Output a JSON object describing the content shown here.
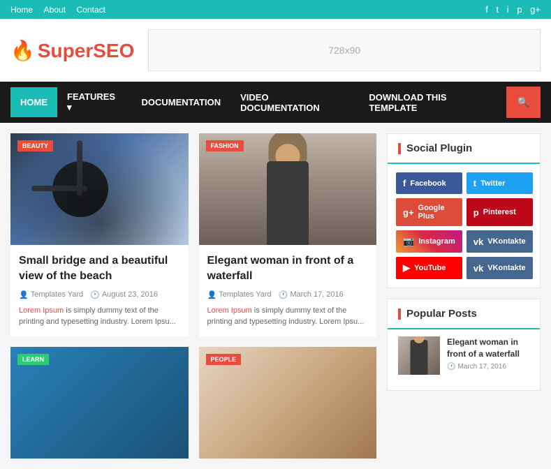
{
  "topbar": {
    "nav": [
      {
        "label": "Home",
        "href": "#"
      },
      {
        "label": "About",
        "href": "#"
      },
      {
        "label": "Contact",
        "href": "#"
      }
    ],
    "social": [
      {
        "icon": "f",
        "name": "facebook"
      },
      {
        "icon": "t",
        "name": "twitter"
      },
      {
        "icon": "i",
        "name": "instagram"
      },
      {
        "icon": "p",
        "name": "pinterest"
      },
      {
        "icon": "g+",
        "name": "googleplus"
      }
    ]
  },
  "header": {
    "logo_prefix": "Super",
    "logo_suffix": "SEO",
    "ad_text": "728x90"
  },
  "nav": {
    "items": [
      {
        "label": "HOME",
        "active": true
      },
      {
        "label": "FEATURES",
        "dropdown": true
      },
      {
        "label": "DOCUMENTATION"
      },
      {
        "label": "VIDEO DOCUMENTATION"
      },
      {
        "label": "DOWNLOAD THIS TEMPLATE"
      }
    ]
  },
  "posts": [
    {
      "badge": "BEAUTY",
      "badge_class": "beauty",
      "title": "Small bridge and a beautiful view of the beach",
      "author": "Templates Yard",
      "date": "August 23, 2016",
      "excerpt": "Lorem Ipsum is simply dummy text of the printing and typesetting industry. Lorem Ipsu...",
      "img_type": "bridge"
    },
    {
      "badge": "FASHION",
      "badge_class": "fashion",
      "title": "Elegant woman in front of a waterfall",
      "author": "Templates Yard",
      "date": "March 17, 2016",
      "excerpt": "Lorem Ipsum is simply dummy text of the printing and typesetting industry. Lorem Ipsu...",
      "img_type": "woman"
    },
    {
      "badge": "LEARN",
      "badge_class": "learn",
      "title": "",
      "img_type": "learn"
    },
    {
      "badge": "PEOPLE",
      "badge_class": "people",
      "title": "",
      "img_type": "people"
    }
  ],
  "sidebar": {
    "social_plugin": {
      "title": "Social Plugin",
      "buttons": [
        {
          "label": "Facebook",
          "class": "facebook",
          "icon": "f"
        },
        {
          "label": "Twitter",
          "class": "twitter",
          "icon": "t"
        },
        {
          "label": "Google Plus",
          "class": "google-plus",
          "icon": "g+"
        },
        {
          "label": "Pinterest",
          "class": "pinterest",
          "icon": "p"
        },
        {
          "label": "Instagram",
          "class": "instagram",
          "icon": "📷"
        },
        {
          "label": "VKontakte",
          "class": "vkontakte",
          "icon": "vk"
        },
        {
          "label": "YouTube",
          "class": "youtube",
          "icon": "▶"
        },
        {
          "label": "VKontakte",
          "class": "vkontakte",
          "icon": "vk"
        }
      ]
    },
    "popular_posts": {
      "title": "Popular Posts",
      "items": [
        {
          "title": "Elegant woman in front of a waterfall",
          "date": "March 17, 2016"
        }
      ]
    }
  }
}
